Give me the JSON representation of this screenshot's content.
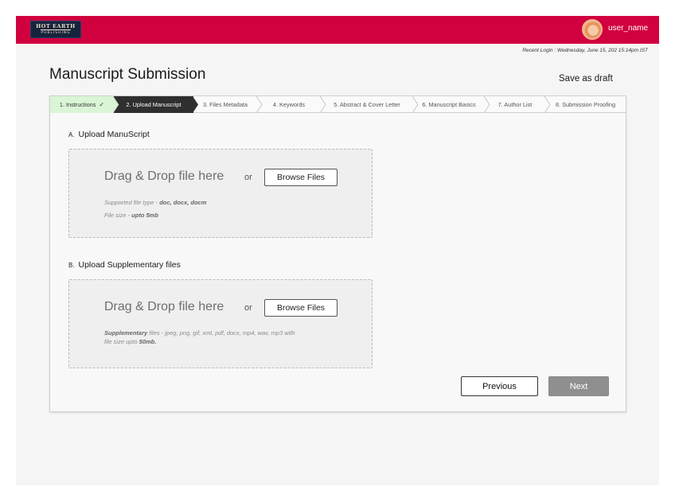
{
  "header": {
    "logo_line1": "HOT EARTH",
    "logo_line2": "PUBLISHING",
    "username": "user_name"
  },
  "recent_login": "Recent Login : Wednesday, June 15, 202  15:14pm IST",
  "page": {
    "title": "Manuscript Submission",
    "save_draft": "Save as draft"
  },
  "steps": [
    {
      "label": "1. Instructions",
      "state": "done",
      "check": "✓"
    },
    {
      "label": "2. Upload Manuscript",
      "state": "active"
    },
    {
      "label": "3. Files Metadata",
      "state": "pending"
    },
    {
      "label": "4. Keywords",
      "state": "pending"
    },
    {
      "label": "5. Abstract & Cover Letter",
      "state": "pending"
    },
    {
      "label": "6. Manuscript Basics",
      "state": "pending"
    },
    {
      "label": "7. Author List",
      "state": "pending"
    },
    {
      "label": "8. Submission Proofing",
      "state": "pending"
    }
  ],
  "upload_manuscript": {
    "letter": "A.",
    "title": "Upload ManuScript",
    "drag_text": "Drag & Drop file here",
    "or": "or",
    "browse": "Browse Files",
    "note_type_prefix": "Supported file type - ",
    "note_type_value": "doc, docx, docm",
    "note_size_prefix": "File size - ",
    "note_size_value": "upto 5mb"
  },
  "upload_supplementary": {
    "letter": "B.",
    "title": "Upload Supplementary files",
    "drag_text": "Drag & Drop file here",
    "or": "or",
    "browse": "Browse Files",
    "note_bold1": "Supplementary",
    "note_line1": " files - jpeg, png, gif, xml, pdf, docx, mp4, wav, mp3  with",
    "note_line2_prefix": "file size upto ",
    "note_line2_value": "50mb."
  },
  "nav": {
    "previous": "Previous",
    "next": "Next"
  },
  "colors": {
    "brand": "#d1003f",
    "step_done": "#d9f5d5",
    "step_active": "#2f2f2f",
    "next_disabled": "#8f8f8f"
  }
}
